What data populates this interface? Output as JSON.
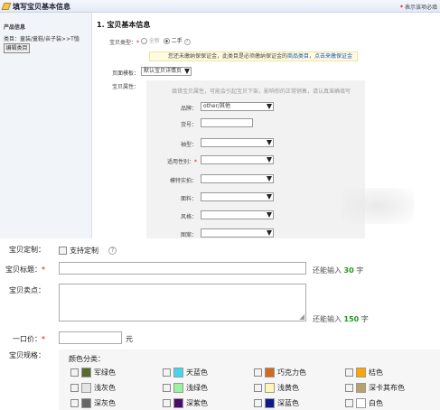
{
  "header": {
    "title": "填写宝贝基本信息",
    "required_note_star": "*",
    "required_note": "表示该项必填"
  },
  "sidebar": {
    "heading": "产品信息",
    "category": "类目：童装/童鞋/亲子装>>T恤",
    "edit_button": "编辑类目"
  },
  "section_title": "1. 宝贝基本信息",
  "item_type": {
    "label": "宝贝类型：",
    "star": "*",
    "options": [
      "全新",
      "二手"
    ],
    "selected": "二手",
    "help": "?"
  },
  "notice": {
    "text": "您还未缴纳保保证金，此类目是必须缴纳保证金的",
    "link_inline": "商品类目",
    "link": "点击来缴保证金"
  },
  "template": {
    "label": "页面模板：",
    "value": "默认宝贝详情页"
  },
  "attrs": {
    "label": "宝贝属性：",
    "tip": "填错宝贝属性，可能会引起宝贝下架，影响你的正常销售，请认真准确填写",
    "fields": [
      {
        "label": "品牌：",
        "value": "other/其他",
        "required": false
      },
      {
        "label": "货号：",
        "value": "",
        "required": false
      },
      {
        "label": "袖型：",
        "value": "",
        "required": false
      },
      {
        "label": "适用性别：",
        "value": "",
        "required": true
      },
      {
        "label": "模特实拍：",
        "value": "",
        "required": false
      },
      {
        "label": "面料：",
        "value": "",
        "required": false
      },
      {
        "label": "风格：",
        "value": "",
        "required": false
      },
      {
        "label": "图案：",
        "value": "",
        "required": false
      }
    ]
  },
  "custom": {
    "label": "宝贝定制：",
    "checkbox_label": "支持定制",
    "help": "?"
  },
  "title": {
    "label": "宝贝标题：",
    "star": "*",
    "value": "",
    "hint_prefix": "还能输入",
    "count": "30",
    "hint_suffix": "字"
  },
  "selling": {
    "label": "宝贝卖点：",
    "value": "",
    "hint_prefix": "还能输入",
    "count": "150",
    "hint_suffix": "字"
  },
  "price": {
    "label": "一口价：",
    "star": "*",
    "value": "",
    "unit": "元"
  },
  "spec": {
    "label": "宝贝规格：",
    "color_label": "颜色分类：",
    "colors": [
      {
        "name": "军绿色",
        "hex": "#5a6a2a"
      },
      {
        "name": "天蓝色",
        "hex": "#44d4ee"
      },
      {
        "name": "巧克力色",
        "hex": "#d2691e"
      },
      {
        "name": "桔色",
        "hex": "#ffa500"
      },
      {
        "name": "浅灰色",
        "hex": "#e4e4e4"
      },
      {
        "name": "浅绿色",
        "hex": "#9cf29c"
      },
      {
        "name": "浅黄色",
        "hex": "#fff7b8"
      },
      {
        "name": "深卡其布色",
        "hex": "#b9a26a"
      },
      {
        "name": "深灰色",
        "hex": "#666666"
      },
      {
        "name": "深紫色",
        "hex": "#4b0a6e"
      },
      {
        "name": "深蓝色",
        "hex": "#0c1a8a"
      },
      {
        "name": "白色",
        "hex": "#ffffff"
      }
    ]
  }
}
